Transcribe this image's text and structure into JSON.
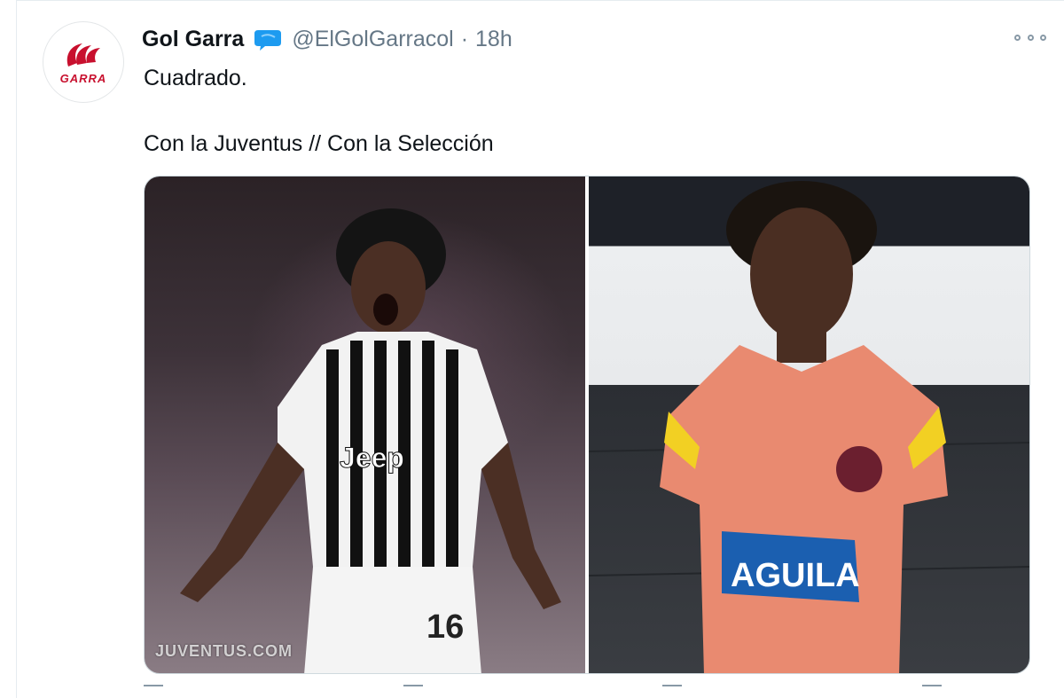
{
  "tweet": {
    "author_name": "Gol Garra",
    "handle": "@ElGolGarracol",
    "separator": "·",
    "time": "18h",
    "avatar_label": "GARRA",
    "text_line1": "Cuadrado.",
    "text_line2": "Con la Juventus // Con la Selección",
    "watermark": "JUVENTUS.COM"
  },
  "icons": {
    "verified": "verified-badge-icon",
    "more": "more-options-icon"
  },
  "colors": {
    "verified": "#1d9bf0",
    "brand_red": "#c8102e",
    "secondary_text": "#657786"
  }
}
